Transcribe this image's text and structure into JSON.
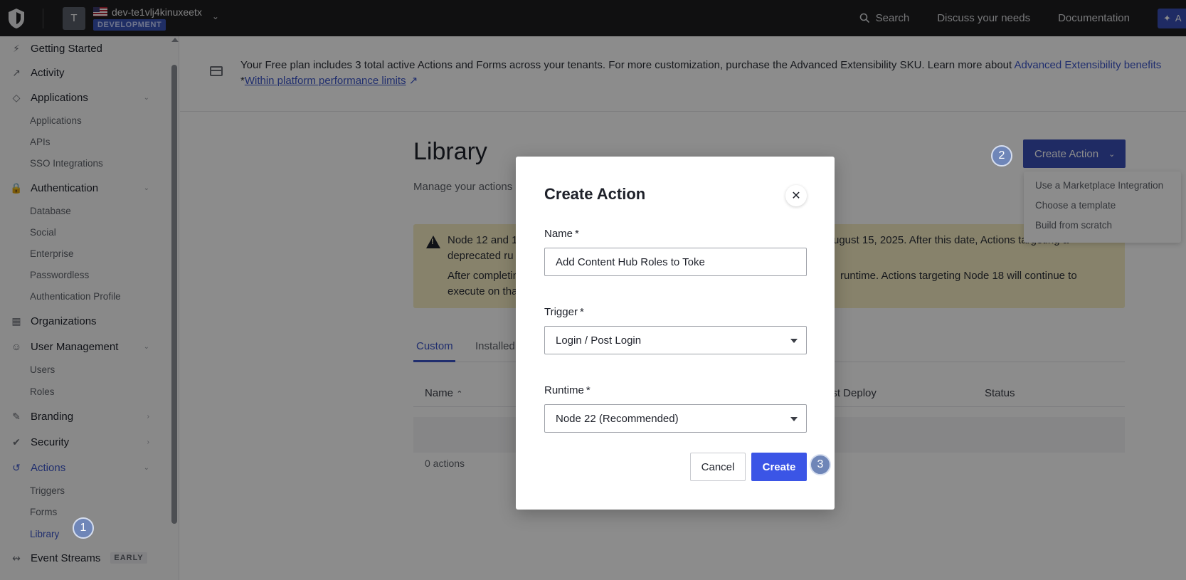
{
  "topbar": {
    "tenant_initial": "T",
    "tenant_name": "dev-te1vlj4kinuxeetx",
    "env_badge": "DEVELOPMENT",
    "search_label": "Search",
    "discuss_label": "Discuss your needs",
    "docs_label": "Documentation",
    "ai_label": "A"
  },
  "sidebar": {
    "getting_started": "Getting Started",
    "activity": "Activity",
    "applications": "Applications",
    "applications_sub": [
      "Applications",
      "APIs",
      "SSO Integrations"
    ],
    "authentication": "Authentication",
    "authentication_sub": [
      "Database",
      "Social",
      "Enterprise",
      "Passwordless",
      "Authentication Profile"
    ],
    "organizations": "Organizations",
    "user_management": "User Management",
    "user_management_sub": [
      "Users",
      "Roles"
    ],
    "branding": "Branding",
    "security": "Security",
    "actions": "Actions",
    "actions_sub": [
      "Triggers",
      "Forms",
      "Library"
    ],
    "event_streams": "Event Streams",
    "early_badge": "EARLY"
  },
  "banner": {
    "text": "Your Free plan includes 3 total active Actions and Forms across your tenants. For more customization, purchase the Advanced Extensibility SKU. Learn more about ",
    "link1": "Advanced Extensibility benefits",
    "asterisk": "*",
    "link2": "Within platform performance limits"
  },
  "library": {
    "title": "Library",
    "subtitle": "Manage your actions",
    "create_action_label": "Create Action",
    "dropdown": [
      "Use a Marketplace Integration",
      "Choose a template",
      "Build from scratch"
    ]
  },
  "warning": {
    "line1a": "Node 12 and 16",
    "line1b": "ugust 15, 2025. After this date, Actions targeting a",
    "line2": "deprecated ru",
    "line3a": "After completin",
    "line3b": "runtime. Actions targeting Node 18 will continue to",
    "line4": "execute on tha"
  },
  "tabs": [
    "Custom",
    "Installed"
  ],
  "table": {
    "col_name": "Name",
    "col_last_deploy": "ast Deploy",
    "col_status": "Status",
    "empty_tail": ".",
    "count": "0 actions"
  },
  "modal": {
    "title": "Create Action",
    "name_label": "Name",
    "name_value": "Add Content Hub Roles to Toke",
    "trigger_label": "Trigger",
    "trigger_value": "Login / Post Login",
    "runtime_label": "Runtime",
    "runtime_value": "Node 22 (Recommended)",
    "required_mark": "*",
    "cancel_label": "Cancel",
    "create_label": "Create"
  },
  "steps": [
    "1",
    "2",
    "3"
  ],
  "colors": {
    "accent": "#3b55c9",
    "primary_button": "#3b55e6",
    "warning_bg": "#f6edc3",
    "topbar_bg": "#1e1e1f"
  }
}
